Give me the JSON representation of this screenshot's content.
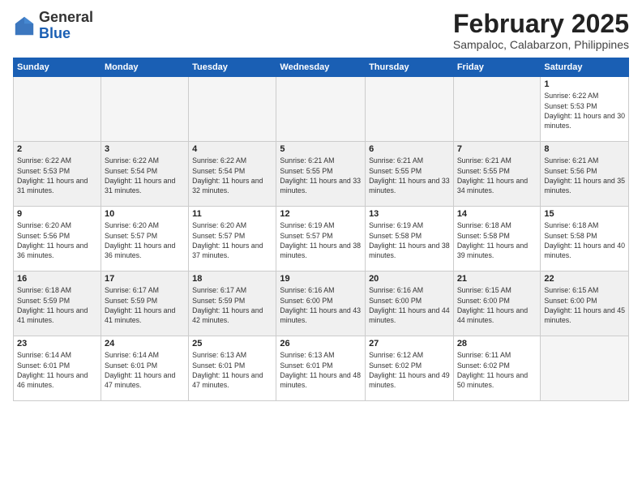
{
  "logo": {
    "general": "General",
    "blue": "Blue"
  },
  "title": "February 2025",
  "subtitle": "Sampaloc, Calabarzon, Philippines",
  "days_of_week": [
    "Sunday",
    "Monday",
    "Tuesday",
    "Wednesday",
    "Thursday",
    "Friday",
    "Saturday"
  ],
  "weeks": [
    [
      {
        "day": "",
        "info": ""
      },
      {
        "day": "",
        "info": ""
      },
      {
        "day": "",
        "info": ""
      },
      {
        "day": "",
        "info": ""
      },
      {
        "day": "",
        "info": ""
      },
      {
        "day": "",
        "info": ""
      },
      {
        "day": "1",
        "info": "Sunrise: 6:22 AM\nSunset: 5:53 PM\nDaylight: 11 hours and 30 minutes."
      }
    ],
    [
      {
        "day": "2",
        "info": "Sunrise: 6:22 AM\nSunset: 5:53 PM\nDaylight: 11 hours and 31 minutes."
      },
      {
        "day": "3",
        "info": "Sunrise: 6:22 AM\nSunset: 5:54 PM\nDaylight: 11 hours and 31 minutes."
      },
      {
        "day": "4",
        "info": "Sunrise: 6:22 AM\nSunset: 5:54 PM\nDaylight: 11 hours and 32 minutes."
      },
      {
        "day": "5",
        "info": "Sunrise: 6:21 AM\nSunset: 5:55 PM\nDaylight: 11 hours and 33 minutes."
      },
      {
        "day": "6",
        "info": "Sunrise: 6:21 AM\nSunset: 5:55 PM\nDaylight: 11 hours and 33 minutes."
      },
      {
        "day": "7",
        "info": "Sunrise: 6:21 AM\nSunset: 5:55 PM\nDaylight: 11 hours and 34 minutes."
      },
      {
        "day": "8",
        "info": "Sunrise: 6:21 AM\nSunset: 5:56 PM\nDaylight: 11 hours and 35 minutes."
      }
    ],
    [
      {
        "day": "9",
        "info": "Sunrise: 6:20 AM\nSunset: 5:56 PM\nDaylight: 11 hours and 36 minutes."
      },
      {
        "day": "10",
        "info": "Sunrise: 6:20 AM\nSunset: 5:57 PM\nDaylight: 11 hours and 36 minutes."
      },
      {
        "day": "11",
        "info": "Sunrise: 6:20 AM\nSunset: 5:57 PM\nDaylight: 11 hours and 37 minutes."
      },
      {
        "day": "12",
        "info": "Sunrise: 6:19 AM\nSunset: 5:57 PM\nDaylight: 11 hours and 38 minutes."
      },
      {
        "day": "13",
        "info": "Sunrise: 6:19 AM\nSunset: 5:58 PM\nDaylight: 11 hours and 38 minutes."
      },
      {
        "day": "14",
        "info": "Sunrise: 6:18 AM\nSunset: 5:58 PM\nDaylight: 11 hours and 39 minutes."
      },
      {
        "day": "15",
        "info": "Sunrise: 6:18 AM\nSunset: 5:58 PM\nDaylight: 11 hours and 40 minutes."
      }
    ],
    [
      {
        "day": "16",
        "info": "Sunrise: 6:18 AM\nSunset: 5:59 PM\nDaylight: 11 hours and 41 minutes."
      },
      {
        "day": "17",
        "info": "Sunrise: 6:17 AM\nSunset: 5:59 PM\nDaylight: 11 hours and 41 minutes."
      },
      {
        "day": "18",
        "info": "Sunrise: 6:17 AM\nSunset: 5:59 PM\nDaylight: 11 hours and 42 minutes."
      },
      {
        "day": "19",
        "info": "Sunrise: 6:16 AM\nSunset: 6:00 PM\nDaylight: 11 hours and 43 minutes."
      },
      {
        "day": "20",
        "info": "Sunrise: 6:16 AM\nSunset: 6:00 PM\nDaylight: 11 hours and 44 minutes."
      },
      {
        "day": "21",
        "info": "Sunrise: 6:15 AM\nSunset: 6:00 PM\nDaylight: 11 hours and 44 minutes."
      },
      {
        "day": "22",
        "info": "Sunrise: 6:15 AM\nSunset: 6:00 PM\nDaylight: 11 hours and 45 minutes."
      }
    ],
    [
      {
        "day": "23",
        "info": "Sunrise: 6:14 AM\nSunset: 6:01 PM\nDaylight: 11 hours and 46 minutes."
      },
      {
        "day": "24",
        "info": "Sunrise: 6:14 AM\nSunset: 6:01 PM\nDaylight: 11 hours and 47 minutes."
      },
      {
        "day": "25",
        "info": "Sunrise: 6:13 AM\nSunset: 6:01 PM\nDaylight: 11 hours and 47 minutes."
      },
      {
        "day": "26",
        "info": "Sunrise: 6:13 AM\nSunset: 6:01 PM\nDaylight: 11 hours and 48 minutes."
      },
      {
        "day": "27",
        "info": "Sunrise: 6:12 AM\nSunset: 6:02 PM\nDaylight: 11 hours and 49 minutes."
      },
      {
        "day": "28",
        "info": "Sunrise: 6:11 AM\nSunset: 6:02 PM\nDaylight: 11 hours and 50 minutes."
      },
      {
        "day": "",
        "info": ""
      }
    ]
  ]
}
